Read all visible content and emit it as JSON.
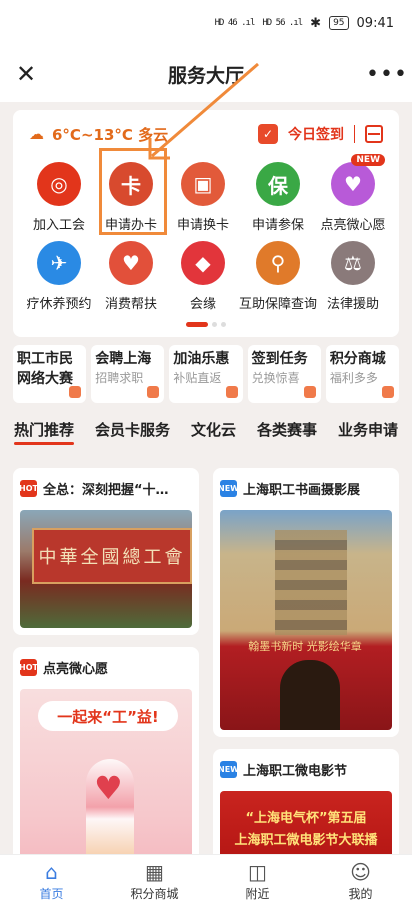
{
  "status_bar": {
    "signal_left": "HD 46 .ıl",
    "signal_right": "HD 56 .ıl",
    "battery": "95",
    "time": "09:41"
  },
  "header": {
    "title": "服务大厅",
    "close_icon": "close-icon",
    "more_icon": "more-icon"
  },
  "weather": {
    "text": "6°C~13°C 多云",
    "icon": "weather-cloud-sun-icon"
  },
  "checkin": {
    "label": "今日签到",
    "icon": "calendar-check-icon",
    "scan_icon": "scan-icon"
  },
  "services": [
    {
      "label": "加入工会",
      "icon": "union-emblem-icon",
      "color": "#e2351b",
      "glyph": "◎"
    },
    {
      "label": "申请办卡",
      "icon": "union-card-icon",
      "color": "#d84a2e",
      "glyph": "卡"
    },
    {
      "label": "申请换卡",
      "icon": "card-swap-icon",
      "color": "#e25a3a",
      "glyph": "▣"
    },
    {
      "label": "申请参保",
      "icon": "insurance-shield-icon",
      "color": "#3aa845",
      "glyph": "保"
    },
    {
      "label": "点亮微心愿",
      "icon": "wish-bottle-icon",
      "color": "#b85ad8",
      "glyph": "♥",
      "badge": "NEW"
    },
    {
      "label": "疗休养预约",
      "icon": "bird-icon",
      "color": "#2a8ae4",
      "glyph": "✈"
    },
    {
      "label": "消费帮扶",
      "icon": "heart-hands-icon",
      "color": "#e2503a",
      "glyph": "♥"
    },
    {
      "label": "会缘",
      "icon": "ring-gift-icon",
      "color": "#e2353b",
      "glyph": "◆"
    },
    {
      "label": "互助保障查询",
      "icon": "search-document-icon",
      "color": "#e07a2a",
      "glyph": "⚲"
    },
    {
      "label": "法律援助",
      "icon": "lawyer-icon",
      "color": "#8a7a7a",
      "glyph": "⚖"
    }
  ],
  "pager": {
    "count": 3,
    "active": 0
  },
  "promos": [
    {
      "title": "职工市民",
      "sub": "网络大赛",
      "sub_is_title": true
    },
    {
      "title": "会聘上海",
      "sub": "招聘求职"
    },
    {
      "title": "加油乐惠",
      "sub": "补贴直返"
    },
    {
      "title": "签到任务",
      "sub": "兑换惊喜"
    },
    {
      "title": "积分商城",
      "sub": "福利多多"
    }
  ],
  "tabs": [
    "热门推荐",
    "会员卡服务",
    "文化云",
    "各类赛事",
    "业务申请"
  ],
  "feed_left": [
    {
      "tag": "HOT",
      "title": "全总：深刻把握“十…",
      "image_text": "中華全國總工會"
    },
    {
      "tag": "HOT",
      "title": "点亮微心愿",
      "image_text": "一起来“工”益!"
    }
  ],
  "feed_right": [
    {
      "tag": "NEW",
      "title": "上海职工书画摄影展",
      "image_text": "翰墨书新时 光影绘华章"
    },
    {
      "tag": "NEW",
      "title": "上海职工微电影节",
      "image_line1": "“上海电气杯”第五届",
      "image_line2": "上海职工微电影节大联播"
    }
  ],
  "bottom_nav": [
    {
      "label": "首页",
      "icon": "home-icon",
      "glyph": "⌂",
      "active": true
    },
    {
      "label": "积分商城",
      "icon": "store-icon",
      "glyph": "▦"
    },
    {
      "label": "附近",
      "icon": "nearby-icon",
      "glyph": "◫"
    },
    {
      "label": "我的",
      "icon": "user-icon",
      "glyph": "☺"
    }
  ],
  "accent_color": "#e2351b"
}
